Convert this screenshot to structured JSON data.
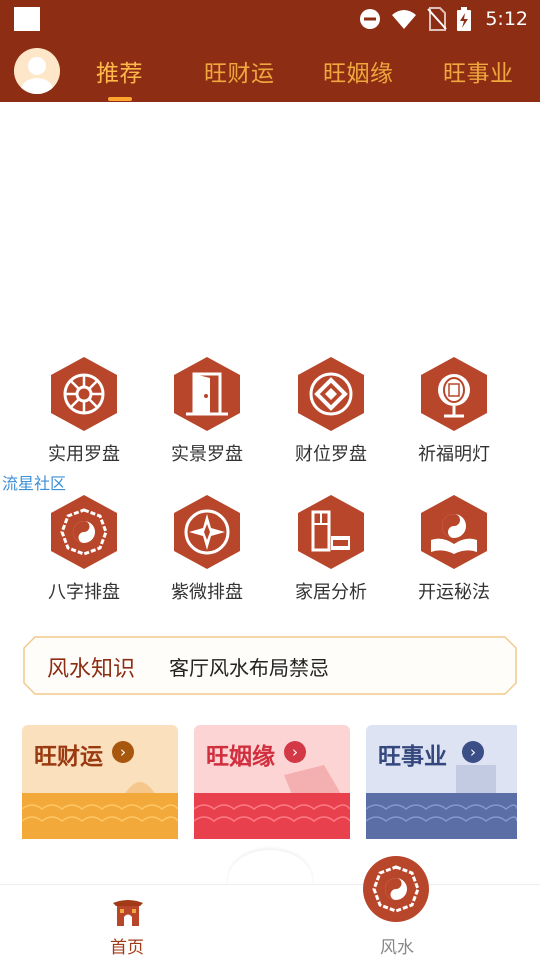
{
  "status_bar": {
    "time": "5:12",
    "icons": [
      "notification-square-icon",
      "do-not-disturb-icon",
      "wifi-icon",
      "no-sim-icon",
      "battery-charging-icon"
    ]
  },
  "header": {
    "tabs": [
      {
        "label": "推荐",
        "active": true
      },
      {
        "label": "旺财运",
        "active": false
      },
      {
        "label": "旺姻缘",
        "active": false
      },
      {
        "label": "旺事业",
        "active": false
      }
    ],
    "accent_color": "#8d2e14",
    "tab_color": "#f0a73d"
  },
  "tools": [
    {
      "label": "实用罗盘",
      "icon": "compass-icon"
    },
    {
      "label": "实景罗盘",
      "icon": "door-icon"
    },
    {
      "label": "财位罗盘",
      "icon": "coin-icon"
    },
    {
      "label": "祈福明灯",
      "icon": "lantern-icon"
    },
    {
      "label": "八字排盘",
      "icon": "bagua-icon"
    },
    {
      "label": "紫微排盘",
      "icon": "star-compass-icon"
    },
    {
      "label": "家居分析",
      "icon": "furniture-icon"
    },
    {
      "label": "开运秘法",
      "icon": "yinyang-book-icon"
    }
  ],
  "community_link": "流星社区",
  "knowledge": {
    "title": "风水知识",
    "headline": "客厅风水布局禁忌"
  },
  "cards": [
    {
      "title": "旺财运",
      "theme": "#e9a23a"
    },
    {
      "title": "旺姻缘",
      "theme": "#e8414d"
    },
    {
      "title": "旺事业",
      "theme": "#5b6ea6"
    }
  ],
  "bottom_nav": [
    {
      "label": "首页",
      "icon": "temple-gate-icon",
      "active": true
    },
    {
      "label": "风水",
      "icon": "bagua-icon",
      "active": false
    }
  ]
}
